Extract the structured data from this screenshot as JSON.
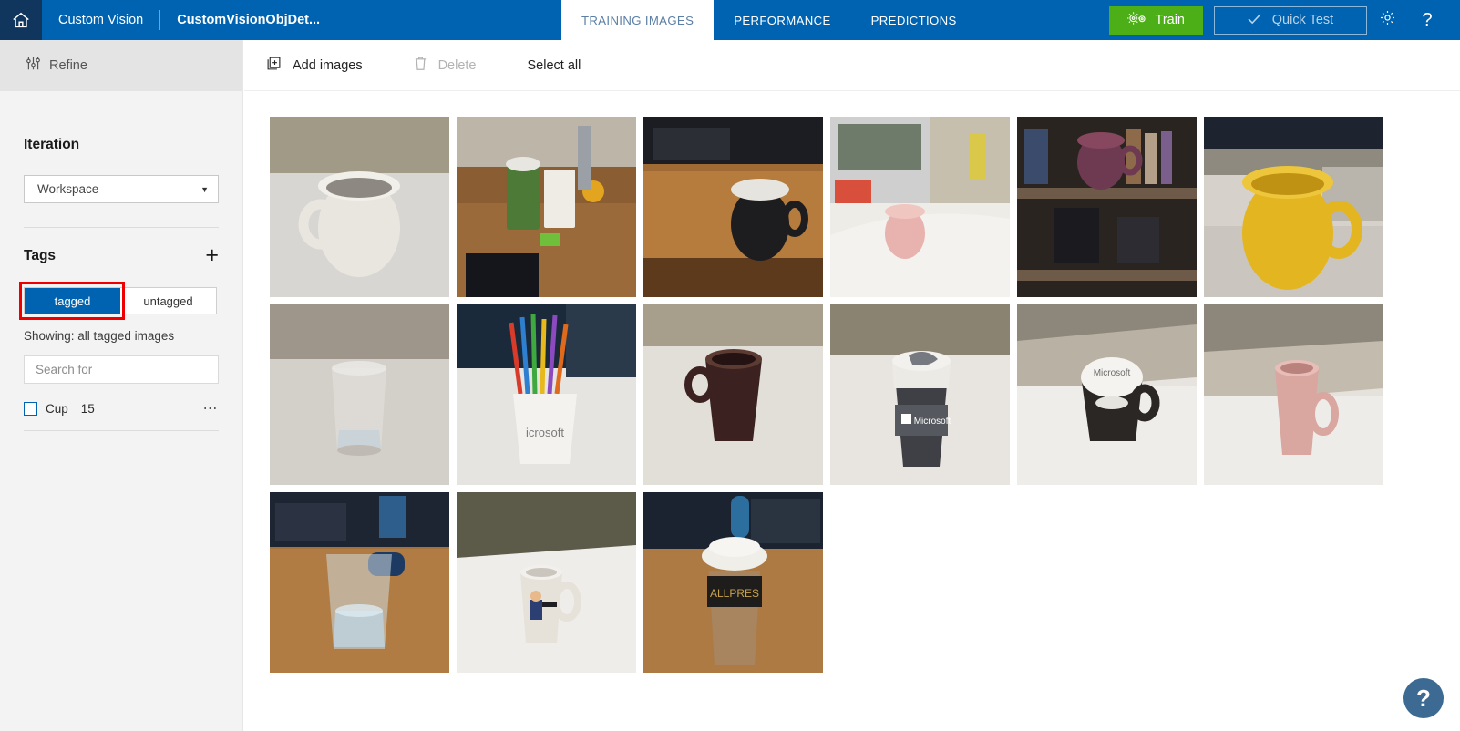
{
  "header": {
    "home_icon": "home-icon",
    "brand": "Custom Vision",
    "project_name": "CustomVisionObjDet...",
    "tabs": [
      {
        "label": "TRAINING IMAGES",
        "active": true
      },
      {
        "label": "PERFORMANCE",
        "active": false
      },
      {
        "label": "PREDICTIONS",
        "active": false
      }
    ],
    "train_label": "Train",
    "train_icon": "gears-icon",
    "train_color": "#4CAF17",
    "quick_test_label": "Quick Test",
    "quick_test_icon": "check-icon",
    "settings_icon": "gear-icon",
    "help_icon": "question-mark-icon",
    "bar_color": "#0063B1",
    "home_bg_color": "#10365E"
  },
  "sidebar": {
    "refine_label": "Refine",
    "refine_icon": "sliders-icon",
    "iteration_title": "Iteration",
    "iteration_value": "Workspace",
    "tags_title": "Tags",
    "add_tag_icon": "plus-icon",
    "toggle": {
      "tagged_label": "tagged",
      "untagged_label": "untagged",
      "selected": "tagged",
      "highlight_color": "#EE0000"
    },
    "showing_text": "Showing: all tagged images",
    "search_placeholder": "Search for",
    "search_value": "",
    "tags": [
      {
        "name": "Cup",
        "count": "15",
        "checked": false,
        "menu_icon": "ellipsis-icon"
      }
    ]
  },
  "toolbar": {
    "add_images_label": "Add images",
    "add_images_icon": "add-image-icon",
    "delete_label": "Delete",
    "delete_icon": "trash-icon",
    "delete_disabled": true,
    "select_all_label": "Select all"
  },
  "grid": {
    "tiles": [
      {
        "alt": "white ceramic mug on white table"
      },
      {
        "alt": "green takeaway cup and white mug on wooden desk"
      },
      {
        "alt": "black Microsoft Do Epic mug on wooden desk"
      },
      {
        "alt": "pink mug on white counter near microwave"
      },
      {
        "alt": "purple mug on bookshelf"
      },
      {
        "alt": "yellow mug beside laptop"
      },
      {
        "alt": "empty drinking glass on white table"
      },
      {
        "alt": "white Microsoft mug holding coloured pencils"
      },
      {
        "alt": "dark brown mug on white table"
      },
      {
        "alt": "grey Microsoft keep-cup travel mug"
      },
      {
        "alt": "black and white Microsoft cup tipped forward"
      },
      {
        "alt": "tall pink mug on white table"
      },
      {
        "alt": "glass of water on wooden desk with keyboard"
      },
      {
        "alt": "white mug with cartoon character on white table"
      },
      {
        "alt": "Allpress takeaway coffee cup on wooden desk"
      }
    ]
  },
  "floating_help": {
    "label": "?",
    "color": "#3C6A93"
  }
}
